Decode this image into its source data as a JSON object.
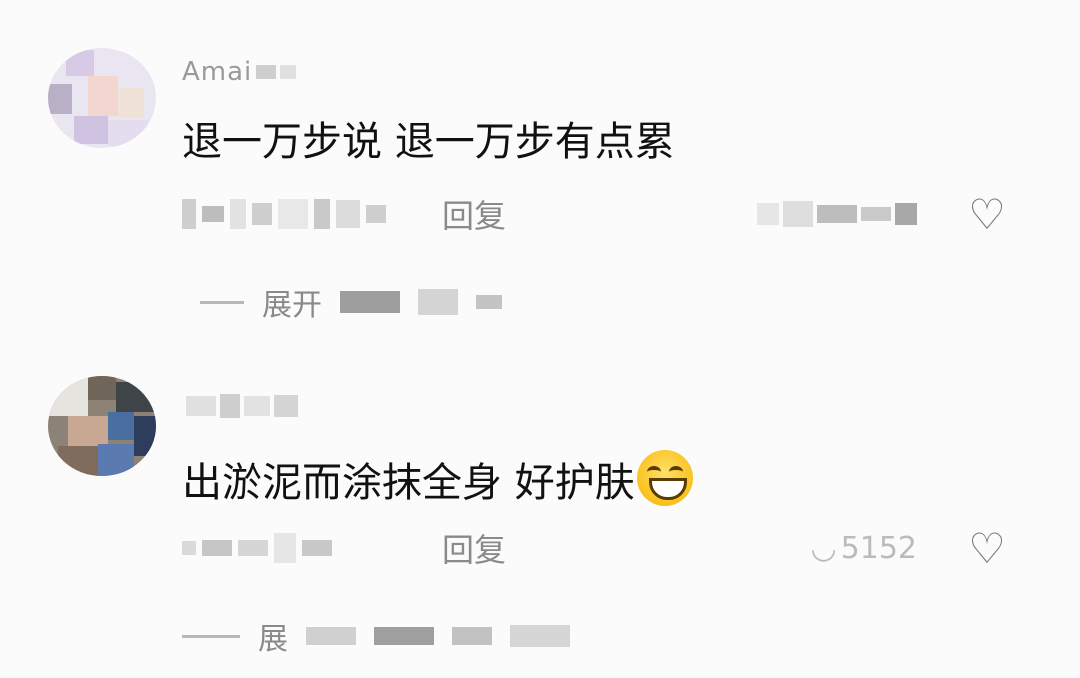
{
  "comments": [
    {
      "username": "Amai",
      "text": "退一万步说 退一万步有点累",
      "reply_label": "回复",
      "expand_label": "展开"
    },
    {
      "username": "",
      "text": "出淤泥而涂抹全身 好护肤",
      "emoji": "grinning-squinting-face",
      "reply_label": "回复",
      "like_count": "5152",
      "expand_label": "展"
    }
  ],
  "colors": {
    "text": "#111111",
    "meta": "#8a8a8a",
    "background": "#fbfbfb"
  }
}
